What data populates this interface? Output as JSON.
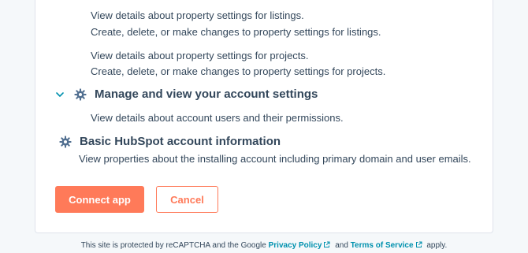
{
  "permissions": {
    "listings_read": "View details about property settings for listings.",
    "listings_write": "Create, delete, or make changes to property settings for listings.",
    "projects_read": "View details about property settings for projects.",
    "projects_write": "Create, delete, or make changes to property settings for projects."
  },
  "account_settings": {
    "title": "Manage and view your account settings",
    "desc": "View details about account users and their permissions.",
    "icon": "gear-icon",
    "expand_icon": "chevron-down-icon"
  },
  "basic_info": {
    "title": "Basic HubSpot account information",
    "desc": "View properties about the installing account including primary domain and user emails.",
    "icon": "gear-icon"
  },
  "actions": {
    "connect_label": "Connect app",
    "cancel_label": "Cancel"
  },
  "footer": {
    "prefix": "This site is protected by reCAPTCHA and the Google",
    "privacy_label": "Privacy Policy",
    "and": "and",
    "terms_label": "Terms of Service",
    "suffix": "apply."
  },
  "colors": {
    "accent": "#ff7a59",
    "link": "#0091ae",
    "text": "#33475b",
    "background": "#f5f8fa"
  }
}
